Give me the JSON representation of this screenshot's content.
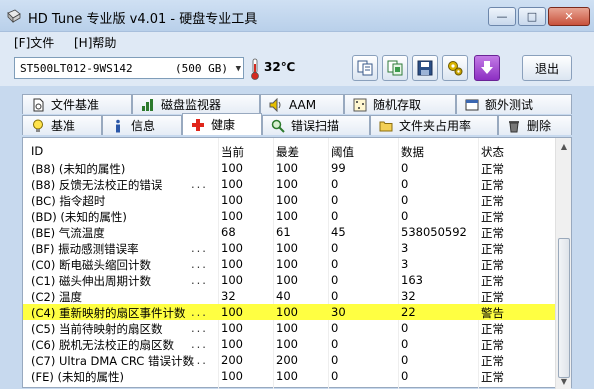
{
  "window": {
    "title": "HD Tune 专业版 v4.01 - 硬盘专业工具",
    "minimize": "—",
    "maximize": "□",
    "close": "✕"
  },
  "menu": {
    "file": "[F]文件",
    "help": "[H]帮助"
  },
  "toolbar": {
    "drive_model": "ST500LT012-9WS142",
    "drive_size": "(500 GB)",
    "temperature": "32℃",
    "exit_label": "退出",
    "icons": [
      "copy-text-icon",
      "copy-screenshot-icon",
      "save-icon",
      "options-icon",
      "download-icon"
    ]
  },
  "tabs_top": [
    "文件基准",
    "磁盘监视器",
    "AAM",
    "随机存取",
    "额外测试"
  ],
  "tabs_bottom": [
    "基准",
    "信息",
    "健康",
    "错误扫描",
    "文件夹占用率",
    "删除"
  ],
  "active_tab": "健康",
  "table": {
    "headers": [
      "ID",
      "当前",
      "最差",
      "阈值",
      "数据",
      "状态"
    ],
    "rows": [
      {
        "id": "(B8) (未知的属性)",
        "dots": "",
        "current": "100",
        "worst": "100",
        "threshold": "99",
        "data": "0",
        "status": "正常"
      },
      {
        "id": "(B8) 反馈无法校正的错误",
        "dots": "...",
        "current": "100",
        "worst": "100",
        "threshold": "0",
        "data": "0",
        "status": "正常"
      },
      {
        "id": "(BC) 指令超时",
        "dots": "",
        "current": "100",
        "worst": "100",
        "threshold": "0",
        "data": "0",
        "status": "正常"
      },
      {
        "id": "(BD) (未知的属性)",
        "dots": "",
        "current": "100",
        "worst": "100",
        "threshold": "0",
        "data": "0",
        "status": "正常"
      },
      {
        "id": "(BE) 气流温度",
        "dots": "",
        "current": "68",
        "worst": "61",
        "threshold": "45",
        "data": "538050592",
        "status": "正常"
      },
      {
        "id": "(BF) 振动感测错误率",
        "dots": "...",
        "current": "100",
        "worst": "100",
        "threshold": "0",
        "data": "3",
        "status": "正常"
      },
      {
        "id": "(C0) 断电磁头缩回计数",
        "dots": "...",
        "current": "100",
        "worst": "100",
        "threshold": "0",
        "data": "3",
        "status": "正常"
      },
      {
        "id": "(C1) 磁头伸出周期计数",
        "dots": "...",
        "current": "100",
        "worst": "100",
        "threshold": "0",
        "data": "163",
        "status": "正常"
      },
      {
        "id": "(C2) 温度",
        "dots": "",
        "current": "32",
        "worst": "40",
        "threshold": "0",
        "data": "32",
        "status": "正常"
      },
      {
        "id": "(C4) 重新映射的扇区事件计数",
        "dots": "...",
        "current": "100",
        "worst": "100",
        "threshold": "30",
        "data": "22",
        "status": "警告"
      },
      {
        "id": "(C5) 当前待映射的扇区数",
        "dots": "...",
        "current": "100",
        "worst": "100",
        "threshold": "0",
        "data": "0",
        "status": "正常"
      },
      {
        "id": "(C6) 脱机无法校正的扇区数",
        "dots": "...",
        "current": "100",
        "worst": "100",
        "threshold": "0",
        "data": "0",
        "status": "正常"
      },
      {
        "id": "(C7) Ultra DMA CRC 错误计数",
        "dots": "...",
        "current": "200",
        "worst": "200",
        "threshold": "0",
        "data": "0",
        "status": "正常"
      },
      {
        "id": "(FE) (未知的属性)",
        "dots": "",
        "current": "100",
        "worst": "100",
        "threshold": "0",
        "data": "0",
        "status": "正常"
      }
    ],
    "highlight_row": 9
  },
  "colors": {
    "highlight": "#ffff42",
    "active_tab_icon": "#e0261b"
  }
}
